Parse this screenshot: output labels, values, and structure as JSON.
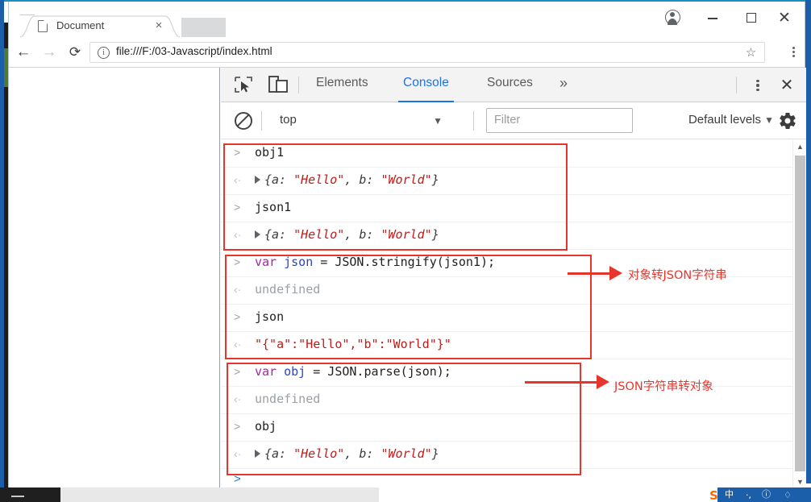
{
  "browser": {
    "tab": {
      "title": "Document",
      "close_label": "×",
      "icon": "page-icon"
    },
    "toolbar": {
      "back_label": "←",
      "forward_label": "→",
      "reload_label": "⟳",
      "info_label": "i",
      "url": "file:///F:/03-Javascript/index.html",
      "star_label": "☆"
    },
    "window": {
      "minimize": "—",
      "maximize": "□",
      "close": "✕"
    }
  },
  "devtools": {
    "tabs": [
      {
        "label": "Elements",
        "active": false
      },
      {
        "label": "Console",
        "active": true
      },
      {
        "label": "Sources",
        "active": false
      }
    ],
    "more_label": "»",
    "close_label": "✕",
    "filterbar": {
      "clear_title": "Clear console",
      "context": "top",
      "caret": "▼",
      "filter_placeholder": "Filter",
      "levels": "Default levels",
      "levels_caret": "▼"
    },
    "console_rows": [
      {
        "kind": "input",
        "marker": ">",
        "segments": [
          {
            "t": "obj1",
            "c": "plain"
          }
        ]
      },
      {
        "kind": "output",
        "marker": "‹·",
        "triangle": true,
        "segments": [
          {
            "t": "{a: ",
            "c": "obj"
          },
          {
            "t": "\"Hello\"",
            "c": "str"
          },
          {
            "t": ", b: ",
            "c": "obj"
          },
          {
            "t": "\"World\"",
            "c": "str"
          },
          {
            "t": "}",
            "c": "obj"
          }
        ]
      },
      {
        "kind": "input",
        "marker": ">",
        "segments": [
          {
            "t": "json1",
            "c": "plain"
          }
        ]
      },
      {
        "kind": "output",
        "marker": "‹·",
        "triangle": true,
        "segments": [
          {
            "t": "{a: ",
            "c": "obj"
          },
          {
            "t": "\"Hello\"",
            "c": "str"
          },
          {
            "t": ", b: ",
            "c": "obj"
          },
          {
            "t": "\"World\"",
            "c": "str"
          },
          {
            "t": "}",
            "c": "obj"
          }
        ]
      },
      {
        "kind": "input",
        "marker": ">",
        "segments": [
          {
            "t": "var ",
            "c": "kw"
          },
          {
            "t": "json",
            "c": "var"
          },
          {
            "t": " = JSON.stringify(json1);",
            "c": "plain"
          }
        ]
      },
      {
        "kind": "output",
        "marker": "‹·",
        "segments": [
          {
            "t": "undefined",
            "c": "undef"
          }
        ]
      },
      {
        "kind": "input",
        "marker": ">",
        "segments": [
          {
            "t": "json",
            "c": "plain"
          }
        ]
      },
      {
        "kind": "output",
        "marker": "‹·",
        "segments": [
          {
            "t": "\"{\"a\":\"Hello\",\"b\":\"World\"}\"",
            "c": "strplain"
          }
        ]
      },
      {
        "kind": "input",
        "marker": ">",
        "segments": [
          {
            "t": "var ",
            "c": "kw"
          },
          {
            "t": "obj",
            "c": "var"
          },
          {
            "t": " = JSON.parse(json);",
            "c": "plain"
          }
        ]
      },
      {
        "kind": "output",
        "marker": "‹·",
        "segments": [
          {
            "t": "undefined",
            "c": "undef"
          }
        ]
      },
      {
        "kind": "input",
        "marker": ">",
        "segments": [
          {
            "t": "obj",
            "c": "plain"
          }
        ]
      },
      {
        "kind": "output",
        "marker": "‹·",
        "triangle": true,
        "segments": [
          {
            "t": "{a: ",
            "c": "obj"
          },
          {
            "t": "\"Hello\"",
            "c": "str"
          },
          {
            "t": ", b: ",
            "c": "obj"
          },
          {
            "t": "\"World\"",
            "c": "str"
          },
          {
            "t": "}",
            "c": "obj"
          }
        ]
      }
    ],
    "prompt_marker": ">",
    "scrollbar": {
      "up": "▲",
      "down": "▼"
    }
  },
  "annotations": [
    {
      "text": "对象转JSON字符串",
      "color": "#e8352b"
    },
    {
      "text": "JSON字符串转对象",
      "color": "#e8352b"
    }
  ],
  "colors": {
    "accent": "#1a73e8",
    "annotation_red": "#e8352b",
    "string_red": "#c41a16",
    "keyword_purple": "#a626a4",
    "variable_blue": "#2b44c7",
    "taskbar_blue": "#1b5faa"
  },
  "taskbar": {
    "ime_lang": "中",
    "ime_dots": "·,",
    "sogou": "S"
  }
}
